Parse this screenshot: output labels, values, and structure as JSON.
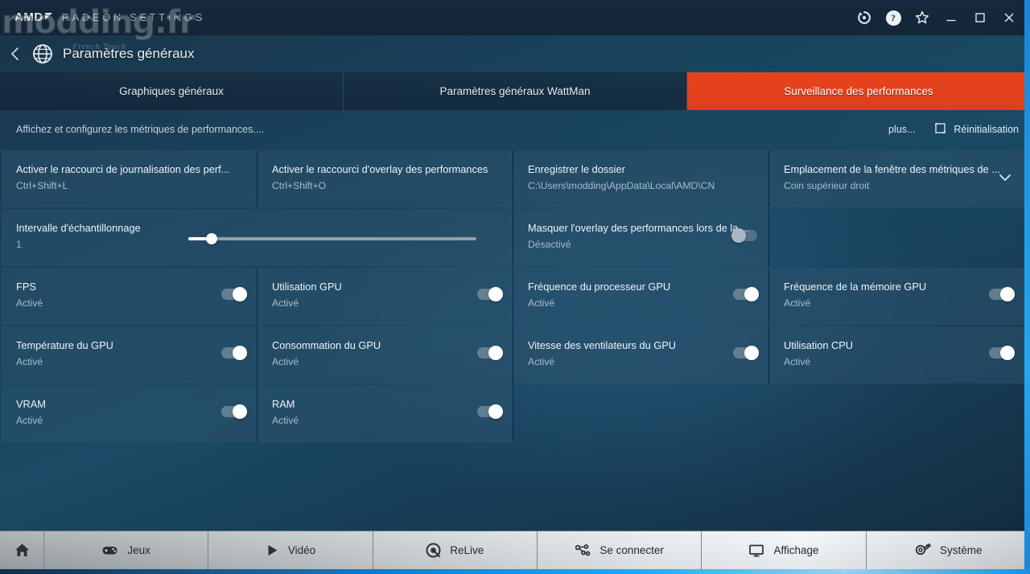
{
  "window": {
    "brand": "AMD",
    "app_title": "RADEON SETTINGS",
    "controls": {
      "update_icon": "refresh-update-icon",
      "help_icon": "help-icon",
      "favorite_icon": "star-icon",
      "minimize_icon": "minimize-icon",
      "maximize_icon": "maximize-icon",
      "close_icon": "close-icon"
    }
  },
  "watermark": {
    "main": "modding.fr",
    "sub": "French Touch"
  },
  "breadcrumb": {
    "back_icon": "chevron-left-icon",
    "section_icon": "globe-icon",
    "title": "Paramètres généraux"
  },
  "tabs": [
    {
      "label": "Graphiques généraux",
      "active": false
    },
    {
      "label": "Paramètres généraux WattMan",
      "active": false
    },
    {
      "label": "Surveillance des performances",
      "active": true
    }
  ],
  "subheader": {
    "description": "Affichez et configurez les métriques de performances....",
    "more_label": "plus...",
    "reset_label": "Réinitialisation",
    "reset_icon": "reset-icon"
  },
  "tiles": [
    {
      "name": "perf-logging-shortcut",
      "title": "Activer le raccourci de journalisation des perf...",
      "value": "Ctrl+Shift+L",
      "control": "none",
      "width": 1
    },
    {
      "name": "perf-overlay-shortcut",
      "title": "Activer le raccourci d'overlay des performances",
      "value": "Ctrl+Shift+O",
      "control": "none",
      "width": 1
    },
    {
      "name": "save-folder",
      "title": "Enregistrer le dossier",
      "value": "C:\\Users\\modding\\AppData\\Local\\AMD\\CN",
      "control": "none",
      "width": 1
    },
    {
      "name": "metrics-window-location",
      "title": "Emplacement de la fenêtre des métriques de ...",
      "value": "Coin supérieur droit",
      "control": "dropdown",
      "width": 1
    },
    {
      "name": "sampling-interval",
      "title": "Intervalle d'échantillonnage",
      "value": "1",
      "control": "slider",
      "slider_percent": 7,
      "width": 2
    },
    {
      "name": "hide-perf-overlay",
      "title": "Masquer l'overlay des performances lors de la ...",
      "value": "Désactivé",
      "control": "toggle-off",
      "width": 1
    },
    {
      "name": "spacer-1",
      "title": "",
      "value": "",
      "control": "empty",
      "width": 1
    },
    {
      "name": "metric-fps",
      "title": "FPS",
      "value": "Activé",
      "control": "toggle-on",
      "width": 1
    },
    {
      "name": "metric-gpu-usage",
      "title": "Utilisation GPU",
      "value": "Activé",
      "control": "toggle-on",
      "width": 1
    },
    {
      "name": "metric-gpu-core-clock",
      "title": "Fréquence du processeur GPU",
      "value": "Activé",
      "control": "toggle-on",
      "width": 1
    },
    {
      "name": "metric-gpu-memory-clock",
      "title": "Fréquence de la mémoire GPU",
      "value": "Activé",
      "control": "toggle-on",
      "width": 1
    },
    {
      "name": "metric-gpu-temperature",
      "title": "Température du GPU",
      "value": "Activé",
      "control": "toggle-on",
      "width": 1
    },
    {
      "name": "metric-gpu-power",
      "title": "Consommation du GPU",
      "value": "Activé",
      "control": "toggle-on",
      "width": 1
    },
    {
      "name": "metric-gpu-fan-speed",
      "title": "Vitesse des ventilateurs du GPU",
      "value": "Activé",
      "control": "toggle-on",
      "width": 1
    },
    {
      "name": "metric-cpu-usage",
      "title": "Utilisation CPU",
      "value": "Activé",
      "control": "toggle-on",
      "width": 1
    },
    {
      "name": "metric-vram",
      "title": "VRAM",
      "value": "Activé",
      "control": "toggle-on",
      "width": 1
    },
    {
      "name": "metric-ram",
      "title": "RAM",
      "value": "Activé",
      "control": "toggle-on",
      "width": 1
    }
  ],
  "bottom_nav": [
    {
      "label": "",
      "icon": "home-icon",
      "name": "nav-home"
    },
    {
      "label": "Jeux",
      "icon": "gamepad-icon",
      "name": "nav-games"
    },
    {
      "label": "Vidéo",
      "icon": "play-icon",
      "name": "nav-video"
    },
    {
      "label": "ReLive",
      "icon": "relive-icon",
      "name": "nav-relive"
    },
    {
      "label": "Se connecter",
      "icon": "connect-icon",
      "name": "nav-connect"
    },
    {
      "label": "Affichage",
      "icon": "display-icon",
      "name": "nav-display"
    },
    {
      "label": "Système",
      "icon": "system-icon",
      "name": "nav-system"
    }
  ],
  "colors": {
    "accent": "#e8441e",
    "window_bg": "#16293c",
    "tile_bg": "#2c526c",
    "desktop_edge": "#24a6f0"
  }
}
